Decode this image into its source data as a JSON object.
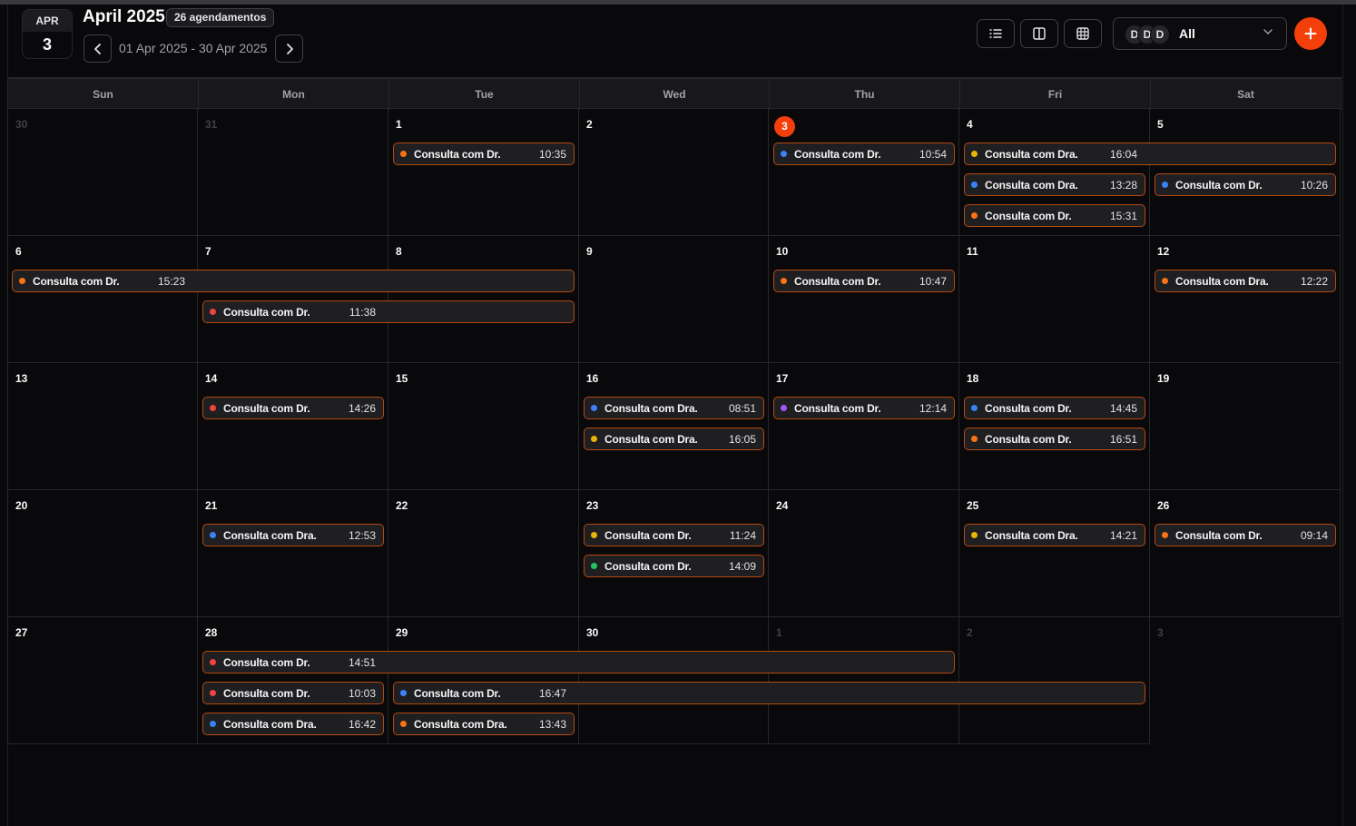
{
  "header": {
    "month_abbr": "APR",
    "day": "3",
    "title": "April 2025",
    "count_badge": "26 agendamentos",
    "date_range": "01 Apr 2025 - 30 Apr 2025",
    "prev_icon": "chevron-left-icon",
    "next_icon": "chevron-right-icon",
    "view_buttons": [
      "list-view-icon",
      "week-view-icon",
      "month-grid-icon"
    ],
    "user_filter": {
      "avatars": [
        "D",
        "D",
        "D"
      ],
      "selected": "All"
    },
    "add_icon": "plus-icon"
  },
  "weekdays": [
    "Sun",
    "Mon",
    "Tue",
    "Wed",
    "Thu",
    "Fri",
    "Sat"
  ],
  "weeks": [
    [
      "30",
      "31",
      "1",
      "2",
      "3",
      "4",
      "5"
    ],
    [
      "6",
      "7",
      "8",
      "9",
      "10",
      "11",
      "12"
    ],
    [
      "13",
      "14",
      "15",
      "16",
      "17",
      "18",
      "19"
    ],
    [
      "20",
      "21",
      "22",
      "23",
      "24",
      "25",
      "26"
    ],
    [
      "27",
      "28",
      "29",
      "30",
      "1",
      "2",
      "3"
    ]
  ],
  "outside_month": [
    [
      true,
      true,
      false,
      false,
      false,
      false,
      false
    ],
    [
      false,
      false,
      false,
      false,
      false,
      false,
      false
    ],
    [
      false,
      false,
      false,
      false,
      false,
      false,
      false
    ],
    [
      false,
      false,
      false,
      false,
      false,
      false,
      false
    ],
    [
      false,
      false,
      false,
      false,
      true,
      true,
      true
    ]
  ],
  "today": {
    "week": 0,
    "col": 4
  },
  "colors": {
    "accent": "#f43f0b",
    "orange": "#f97316",
    "red": "#ef4444",
    "blue": "#3b82f6",
    "amber": "#eab308",
    "purple": "#a855f7",
    "green": "#22c55e"
  },
  "events": [
    {
      "week": 0,
      "col": 2,
      "span": 1,
      "lane": 0,
      "title": "Consulta com Dr.",
      "time": "10:35",
      "color": "#f97316"
    },
    {
      "week": 0,
      "col": 4,
      "span": 1,
      "lane": 0,
      "title": "Consulta com Dr.",
      "time": "10:54",
      "color": "#3b82f6"
    },
    {
      "week": 0,
      "col": 5,
      "span": 2,
      "lane": 0,
      "title": "Consulta com Dra.",
      "time": "16:04",
      "color": "#eab308"
    },
    {
      "week": 0,
      "col": 5,
      "span": 1,
      "lane": 1,
      "title": "Consulta com Dra.",
      "time": "13:28",
      "color": "#3b82f6"
    },
    {
      "week": 0,
      "col": 6,
      "span": 1,
      "lane": 1,
      "title": "Consulta com Dr.",
      "time": "10:26",
      "color": "#3b82f6"
    },
    {
      "week": 0,
      "col": 5,
      "span": 1,
      "lane": 2,
      "title": "Consulta com Dr.",
      "time": "15:31",
      "color": "#f97316"
    },
    {
      "week": 1,
      "col": 0,
      "span": 3,
      "lane": 0,
      "title": "Consulta com Dr.",
      "time": "15:23",
      "color": "#f97316"
    },
    {
      "week": 1,
      "col": 4,
      "span": 1,
      "lane": 0,
      "title": "Consulta com Dr.",
      "time": "10:47",
      "color": "#f97316"
    },
    {
      "week": 1,
      "col": 6,
      "span": 1,
      "lane": 0,
      "title": "Consulta com Dra.",
      "time": "12:22",
      "color": "#f97316"
    },
    {
      "week": 1,
      "col": 1,
      "span": 2,
      "lane": 1,
      "title": "Consulta com Dr.",
      "time": "11:38",
      "color": "#ef4444"
    },
    {
      "week": 2,
      "col": 1,
      "span": 1,
      "lane": 0,
      "title": "Consulta com Dr.",
      "time": "14:26",
      "color": "#ef4444"
    },
    {
      "week": 2,
      "col": 3,
      "span": 1,
      "lane": 0,
      "title": "Consulta com Dra.",
      "time": "08:51",
      "color": "#3b82f6"
    },
    {
      "week": 2,
      "col": 4,
      "span": 1,
      "lane": 0,
      "title": "Consulta com Dr.",
      "time": "12:14",
      "color": "#a855f7"
    },
    {
      "week": 2,
      "col": 5,
      "span": 1,
      "lane": 0,
      "title": "Consulta com Dr.",
      "time": "14:45",
      "color": "#3b82f6"
    },
    {
      "week": 2,
      "col": 3,
      "span": 1,
      "lane": 1,
      "title": "Consulta com Dra.",
      "time": "16:05",
      "color": "#eab308"
    },
    {
      "week": 2,
      "col": 5,
      "span": 1,
      "lane": 1,
      "title": "Consulta com Dr.",
      "time": "16:51",
      "color": "#f97316"
    },
    {
      "week": 3,
      "col": 1,
      "span": 1,
      "lane": 0,
      "title": "Consulta com Dra.",
      "time": "12:53",
      "color": "#3b82f6"
    },
    {
      "week": 3,
      "col": 3,
      "span": 1,
      "lane": 0,
      "title": "Consulta com Dr.",
      "time": "11:24",
      "color": "#eab308"
    },
    {
      "week": 3,
      "col": 5,
      "span": 1,
      "lane": 0,
      "title": "Consulta com Dra.",
      "time": "14:21",
      "color": "#eab308"
    },
    {
      "week": 3,
      "col": 6,
      "span": 1,
      "lane": 0,
      "title": "Consulta com Dr.",
      "time": "09:14",
      "color": "#f97316"
    },
    {
      "week": 3,
      "col": 3,
      "span": 1,
      "lane": 1,
      "title": "Consulta com Dr.",
      "time": "14:09",
      "color": "#22c55e"
    },
    {
      "week": 4,
      "col": 1,
      "span": 4,
      "lane": 0,
      "title": "Consulta com Dr.",
      "time": "14:51",
      "color": "#ef4444"
    },
    {
      "week": 4,
      "col": 1,
      "span": 1,
      "lane": 1,
      "title": "Consulta com Dr.",
      "time": "10:03",
      "color": "#ef4444"
    },
    {
      "week": 4,
      "col": 2,
      "span": 4,
      "lane": 1,
      "title": "Consulta com Dr.",
      "time": "16:47",
      "color": "#3b82f6"
    },
    {
      "week": 4,
      "col": 1,
      "span": 1,
      "lane": 2,
      "title": "Consulta com Dra.",
      "time": "16:42",
      "color": "#3b82f6"
    },
    {
      "week": 4,
      "col": 2,
      "span": 1,
      "lane": 2,
      "title": "Consulta com Dra.",
      "time": "13:43",
      "color": "#f97316"
    }
  ]
}
